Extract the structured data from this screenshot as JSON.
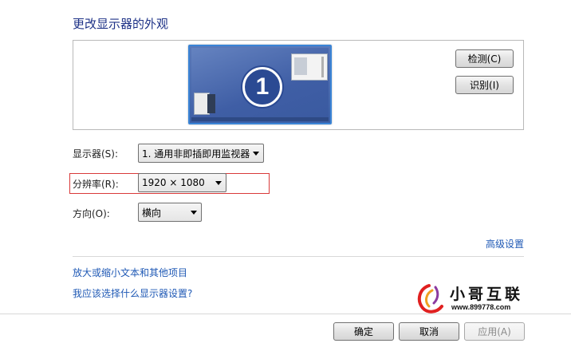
{
  "title": "更改显示器的外观",
  "preview": {
    "monitor_number": "1",
    "detect_label": "检测(C)",
    "identify_label": "识别(I)"
  },
  "display": {
    "label": "显示器(S):",
    "value": "1. 通用非即插即用监视器"
  },
  "resolution": {
    "label": "分辨率(R):",
    "value": "1920 × 1080"
  },
  "orientation": {
    "label": "方向(O):",
    "value": "横向"
  },
  "advanced_link": "高级设置",
  "links": {
    "text_size": "放大或缩小文本和其他项目",
    "which_settings": "我应该选择什么显示器设置?"
  },
  "watermark": {
    "name": "小哥互联",
    "url": "www.899778.com"
  },
  "footer": {
    "ok": "确定",
    "cancel": "取消",
    "apply": "应用(A)"
  },
  "colors": {
    "accent_link": "#1f59b5",
    "title": "#1e3287",
    "highlight": "#d93a3a"
  }
}
